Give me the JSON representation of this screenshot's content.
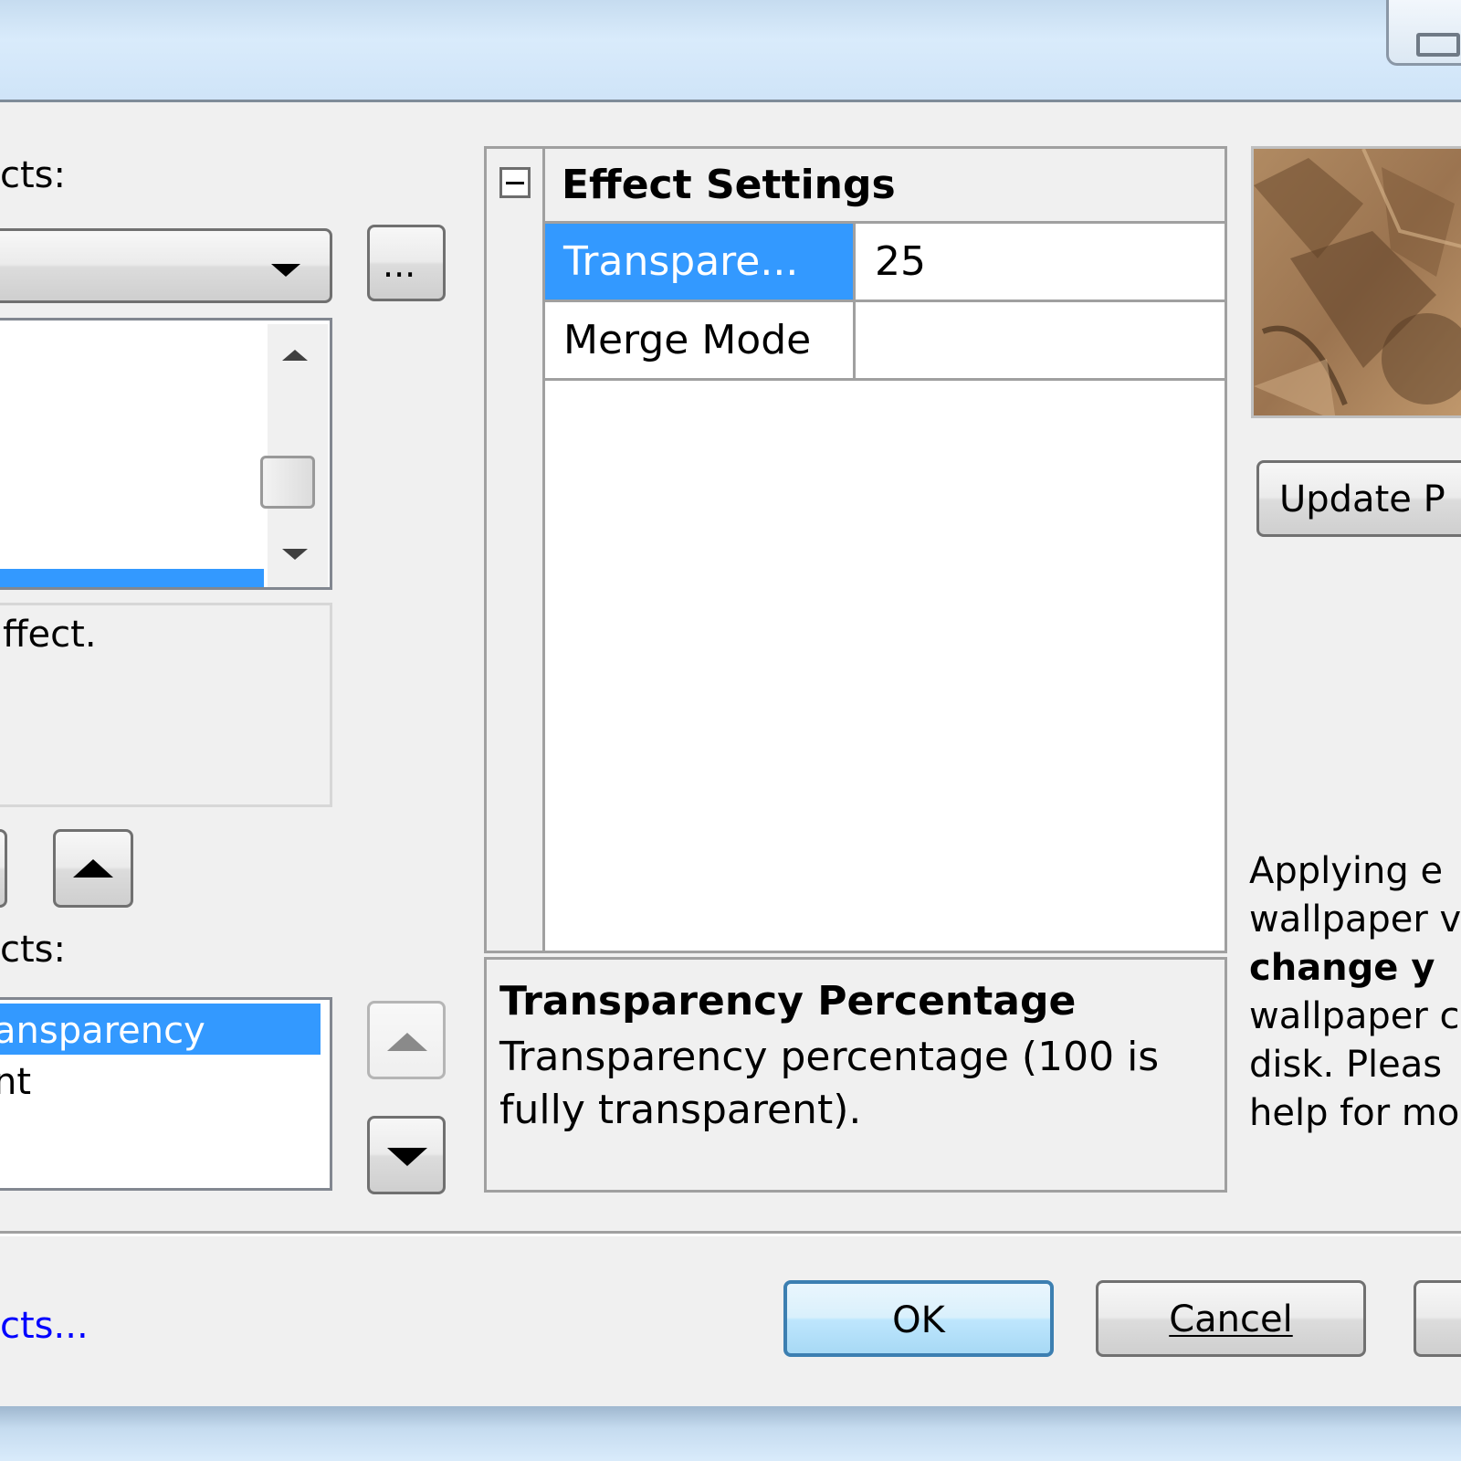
{
  "left_panel": {
    "effects_label": "cts:",
    "browse_button_label": "...",
    "description_text": "ffect.",
    "applied_effects_label": "cts:",
    "applied_list": [
      "ansparency",
      "nt"
    ],
    "more_effects_link": "cts..."
  },
  "property_grid": {
    "category_title": "Effect Settings",
    "collapse_glyph": "−",
    "rows": [
      {
        "name": "Transpare...",
        "value": "25"
      },
      {
        "name": "Merge Mode",
        "value": ""
      }
    ]
  },
  "description": {
    "title": "Transparency Percentage",
    "body": "Transparency percentage (100 is fully transparent)."
  },
  "preview": {
    "update_button_label": "Update P"
  },
  "info_text": {
    "lines": [
      "Applying e",
      "wallpaper v",
      "change y",
      "wallpaper c",
      "disk. Pleas",
      "help for mo"
    ]
  },
  "footer": {
    "ok_label": "OK",
    "cancel_label": "Cancel"
  },
  "colors": {
    "selection": "#3399ff",
    "link": "#0000ff",
    "dialog_bg": "#f0f0f0"
  }
}
